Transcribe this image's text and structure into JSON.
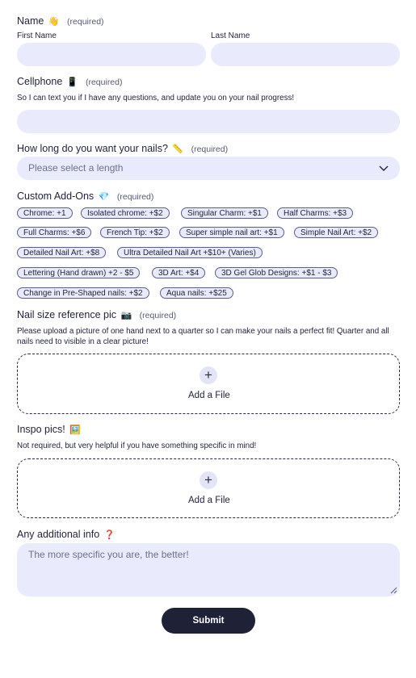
{
  "name": {
    "label": "Name",
    "icon": "waving-hand-icon",
    "emoji": "👋",
    "required": "(required)",
    "first_label": "First Name",
    "first_value": "",
    "last_label": "Last Name",
    "last_value": ""
  },
  "cellphone": {
    "label": "Cellphone",
    "icon": "phone-icon",
    "emoji": "📱",
    "required": "(required)",
    "description": "So I can text you if I have any questions, and update you on your nail progress!",
    "value": ""
  },
  "length": {
    "label": "How long do you want your nails?",
    "icon": "ruler-icon",
    "emoji": "📏",
    "required": "(required)",
    "placeholder": "Please select a length"
  },
  "addons": {
    "label": "Custom Add-Ons",
    "icon": "gem-icon",
    "emoji": "💎",
    "required": "(required)",
    "options": [
      "Chrome: +1",
      "Isolated chrome: +$2",
      "Singular Charm: +$1",
      "Half Charms: +$3",
      "Full Charms: +$6",
      "French Tip: +$2",
      "Super simple nail art: +$1",
      "Simple Nail Art: +$2",
      "Detailed Nail Art: +$8",
      "Ultra Detailed Nail Art +$10+ (Varies)",
      "Lettering (Hand drawn) +2 - $5",
      "3D Art: +$4",
      "3D Gel Glob Designs: +$1 - $3",
      "Change in Pre-Shaped nails: +$2",
      "Aqua nails: +$25"
    ]
  },
  "nail_size": {
    "label": "Nail size reference pic",
    "icon": "camera-icon",
    "emoji": "📷",
    "required": "(required)",
    "description": "Please upload a picture of one hand next to a quarter so I can make your nails a perfect fit! Quarter and all nails need to visible in a clear picture!",
    "add_file": "Add a File"
  },
  "inspo": {
    "label": "Inspo pics!",
    "icon": "picture-icon",
    "emoji": "🖼️",
    "description": "Not required, but very helpful if you have something specific in mind!",
    "add_file": "Add a File"
  },
  "additional": {
    "label": "Any additional info",
    "icon": "question-mark-icon",
    "emoji": "❓",
    "placeholder": "The more specific you are, the better!"
  },
  "submit_label": "Submit",
  "colors": {
    "field_bg": "#e9ebfd",
    "text_dark": "#1f2137",
    "button_bg": "#1f2137",
    "button_text": "#ffffff"
  }
}
